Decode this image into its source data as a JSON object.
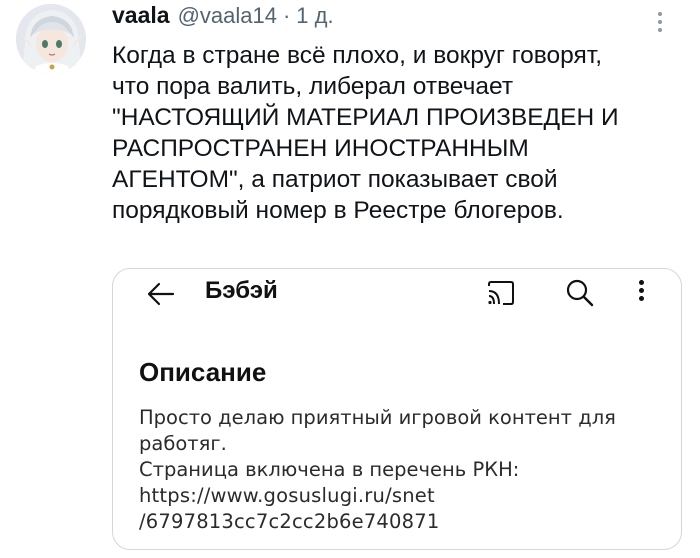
{
  "author": {
    "display_name": "vaala",
    "handle": "@vaala14",
    "separator": "·",
    "time": "1 д."
  },
  "tweet": {
    "lines": [
      "Когда в стране всё плохо, и вокруг говорят,",
      "что пора валить, либерал отвечает",
      "\"НАСТОЯЩИЙ МАТЕРИАЛ ПРОИЗВЕДЕН И",
      "РАСПРОСТРАНЕН ИНОСТРАННЫМ",
      "АГЕНТОМ\", а патриот показывает свой",
      "порядковый номер в Реестре блогеров."
    ]
  },
  "embedded": {
    "channel_title": "Бэбэй",
    "description_heading": "Описание",
    "description_lines": [
      "Просто делаю приятный игровой контент для",
      "работяг.",
      "Страница включена в перечень РКН:",
      "https://www.gosuslugi.ru/snet",
      "/6797813cc7c2cc2b6e740871"
    ]
  },
  "icons": {
    "avatar": "anime-avatar",
    "tweet_menu": "more-vertical-icon",
    "back": "arrow-left-icon",
    "cast": "cast-icon",
    "search": "search-icon",
    "menu": "more-vertical-icon"
  },
  "colors": {
    "text": "#0f1419",
    "secondary": "#536471",
    "border": "#cfd9de"
  }
}
